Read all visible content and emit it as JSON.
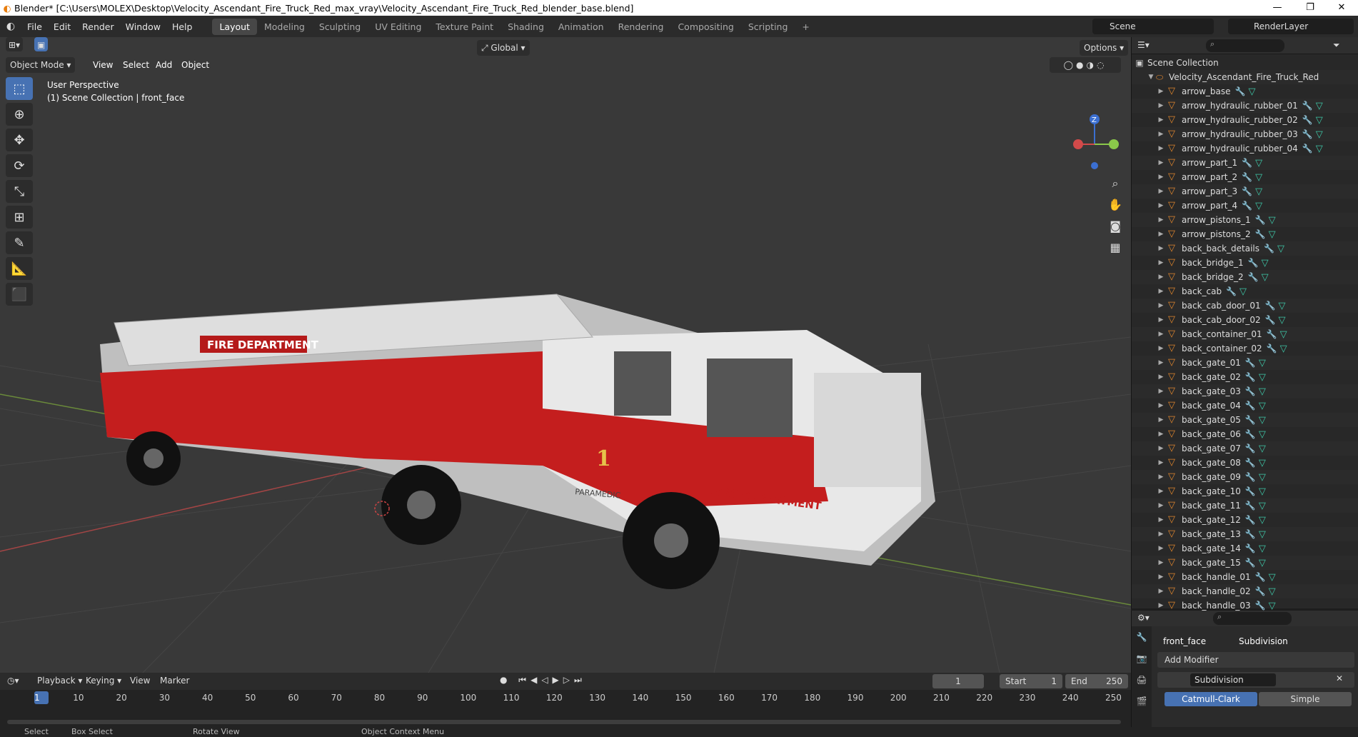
{
  "titlebar": {
    "title": "Blender* [C:\\Users\\MOLEX\\Desktop\\Velocity_Ascendant_Fire_Truck_Red_max_vray\\Velocity_Ascendant_Fire_Truck_Red_blender_base.blend]",
    "minimize": "—",
    "maximize": "❐",
    "close": "✕"
  },
  "menubar": {
    "menus": [
      "File",
      "Edit",
      "Render",
      "Window",
      "Help"
    ],
    "workspaces": [
      "Layout",
      "Modeling",
      "Sculpting",
      "UV Editing",
      "Texture Paint",
      "Shading",
      "Animation",
      "Rendering",
      "Compositing",
      "Scripting"
    ],
    "add_tab": "+",
    "scene_label": "Scene",
    "renderlayer_label": "RenderLayer"
  },
  "viewport": {
    "mode": "Object Mode",
    "menus": [
      "View",
      "Select",
      "Add",
      "Object"
    ],
    "transform": "Global",
    "options": "Options",
    "perspective": "User Perspective",
    "collection_info": "(1) Scene Collection | front_face",
    "truck_labels": [
      "FIRE DEPARTMENT",
      "FIRE DEPARTMENT",
      "PARAMEDIC",
      "1"
    ],
    "gizmo_z": "Z"
  },
  "outliner": {
    "root": "Scene Collection",
    "collection": "Velocity_Ascendant_Fire_Truck_Red",
    "items": [
      "arrow_base",
      "arrow_hydraulic_rubber_01",
      "arrow_hydraulic_rubber_02",
      "arrow_hydraulic_rubber_03",
      "arrow_hydraulic_rubber_04",
      "arrow_part_1",
      "arrow_part_2",
      "arrow_part_3",
      "arrow_part_4",
      "arrow_pistons_1",
      "arrow_pistons_2",
      "back_back_details",
      "back_bridge_1",
      "back_bridge_2",
      "back_cab",
      "back_cab_door_01",
      "back_cab_door_02",
      "back_container_01",
      "back_container_02",
      "back_gate_01",
      "back_gate_02",
      "back_gate_03",
      "back_gate_04",
      "back_gate_05",
      "back_gate_06",
      "back_gate_07",
      "back_gate_08",
      "back_gate_09",
      "back_gate_10",
      "back_gate_11",
      "back_gate_12",
      "back_gate_13",
      "back_gate_14",
      "back_gate_15",
      "back_handle_01",
      "back_handle_02",
      "back_handle_03"
    ]
  },
  "properties": {
    "object_name": "front_face",
    "modifier_tab": "Subdivision",
    "add_modifier": "Add Modifier",
    "modifier_name": "Subdivision",
    "option_a": "Catmull-Clark",
    "option_b": "Simple"
  },
  "timeline": {
    "menus": [
      "Playback",
      "Keying",
      "View",
      "Marker"
    ],
    "current_frame": "1",
    "start_label": "Start",
    "start_value": "1",
    "end_label": "End",
    "end_value": "250",
    "frames": [
      "1",
      "10",
      "20",
      "30",
      "40",
      "50",
      "60",
      "70",
      "80",
      "90",
      "100",
      "110",
      "120",
      "130",
      "140",
      "150",
      "160",
      "170",
      "180",
      "190",
      "200",
      "210",
      "220",
      "230",
      "240",
      "250"
    ]
  },
  "statusbar": {
    "items": [
      "Select",
      "Box Select",
      "Rotate View",
      "Object Context Menu"
    ]
  },
  "colors": {
    "accent": "#4772b3",
    "mesh_orange": "#e0862d",
    "truck_red": "#c41e1e"
  }
}
